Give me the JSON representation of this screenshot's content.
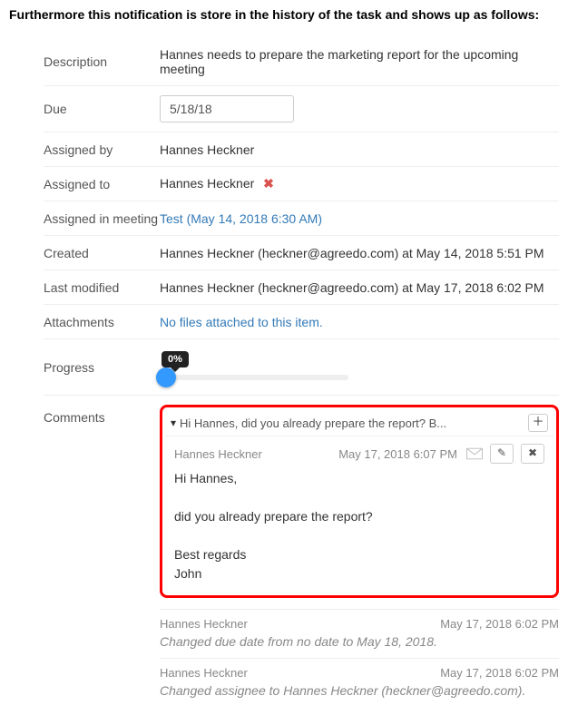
{
  "intro": "Furthermore this notification is store in the history of the task and shows up as follows:",
  "labels": {
    "description": "Description",
    "due": "Due",
    "assigned_by": "Assigned by",
    "assigned_to": "Assigned to",
    "assigned_in_meeting": "Assigned in meeting",
    "created": "Created",
    "last_modified": "Last modified",
    "attachments": "Attachments",
    "progress": "Progress",
    "comments": "Comments"
  },
  "values": {
    "description": "Hannes needs to prepare the marketing report for the upcoming meeting",
    "due": "5/18/18",
    "assigned_by": "Hannes Heckner",
    "assigned_to": "Hannes Heckner",
    "assigned_in_meeting": "Test (May 14, 2018 6:30 AM)",
    "created": "Hannes Heckner (heckner@agreedo.com) at May 14, 2018 5:51 PM",
    "last_modified": "Hannes Heckner (heckner@agreedo.com) at May 17, 2018 6:02 PM",
    "attachments": "No files attached to this item.",
    "progress_pct": "0%"
  },
  "comments": {
    "summary": "Hi Hannes, did you already prepare the report? B...",
    "entries": [
      {
        "author": "Hannes Heckner",
        "time": "May 17, 2018 6:07 PM",
        "body": "Hi Hannes,\n\ndid you already prepare the report?\n\nBest regards\nJohn"
      }
    ]
  },
  "history": [
    {
      "author": "Hannes Heckner",
      "time": "May 17, 2018 6:02 PM",
      "text": "Changed due date from no date to May 18, 2018."
    },
    {
      "author": "Hannes Heckner",
      "time": "May 17, 2018 6:02 PM",
      "text": "Changed assignee to Hannes Heckner (heckner@agreedo.com)."
    }
  ],
  "icons": {
    "remove": "✖",
    "add": "＋",
    "edit": "✎",
    "close": "✖",
    "chevron_down": "▾"
  }
}
